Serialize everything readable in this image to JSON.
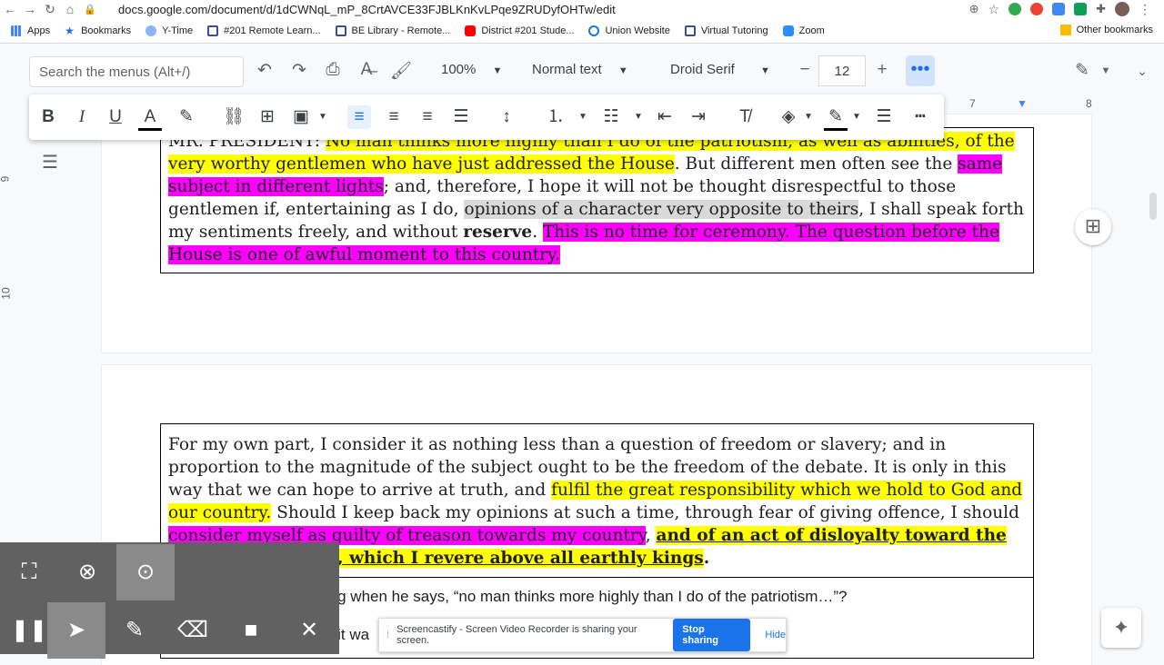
{
  "browser": {
    "url": "docs.google.com/document/d/1dCWNqL_mP_8CrtAVCE33FJBLKnKvLPqe9ZRUDyfOHTw/edit",
    "bookmarks": [
      "Apps",
      "Bookmarks",
      "Y-Time",
      "#201 Remote Learn...",
      "BE Library - Remote...",
      "District #201 Stude...",
      "Union Website",
      "Virtual Tutoring",
      "Zoom"
    ],
    "other_bookmarks": "Other bookmarks"
  },
  "toolbar": {
    "search_placeholder": "Search the menus (Alt+/)",
    "zoom": "100%",
    "style": "Normal text",
    "font": "Droid Serif",
    "font_size": "12",
    "more": "•••"
  },
  "ruler": {
    "mark7": "7",
    "mark8": "8",
    "v9": "9",
    "v10": "10"
  },
  "doc": {
    "p1_a": "MR. PRESIDENT: ",
    "p1_b": "No man thinks more highly than I do of the patriotism, as well as abilities, of the very worthy gentlemen who have just addressed the House",
    "p1_c": ". But different men often see the ",
    "p1_d": "same subject in different lights",
    "p1_e": "; and, therefore, I hope it will not be thought disrespectful to those gentlemen if, entertaining as I do, ",
    "p1_f": "opinions of a character very opposite to theirs",
    "p1_g": ", I shall speak forth my sentiments freely, and without ",
    "p1_h": "reserve",
    "p1_i": ". ",
    "p1_j": "This is no time for ceremony. The question before the House is one of awful moment to this country.",
    "p2_a": "For my own part, I consider it as nothing less than a question of freedom or slavery; and in proportion to the magnitude of the subject ought to be the freedom of the debate. It is only in this way that we can hope to arrive at truth, and ",
    "p2_b": "fulfil the great responsibility which we hold to God and our country.",
    "p2_c": " Should I keep back my opinions at such a time, through fear of giving offence, I should ",
    "p2_d": "consider myself as guilty of treason towards my country",
    "p2_e": ", ",
    "p2_f": "and of an act of disloyalty toward the majesty of heaven, which I revere above all earthly kings",
    "p2_g": ".",
    "q1": "1. What is Henry meaning when he says, “no man thinks more highly than I do of the patriotism…”?",
    "q2": "2. What does Henry say it wa"
  },
  "sharebar": {
    "message": "Screencastify - Screen Video Recorder is sharing your screen.",
    "stop": "Stop sharing",
    "hide": "Hide"
  },
  "icons": {
    "accent": "#1a73e8",
    "highlight_yellow": "#ffff00",
    "highlight_magenta": "#ff00ff"
  }
}
